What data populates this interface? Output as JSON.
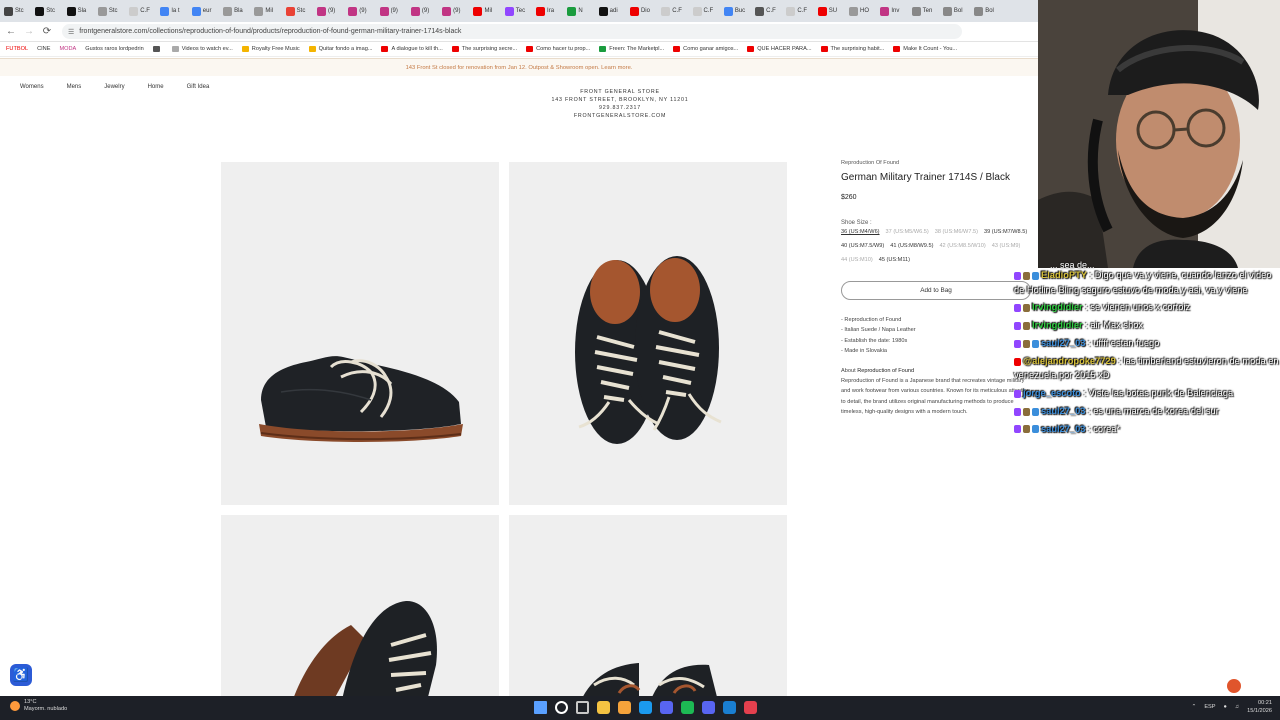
{
  "browser": {
    "tabs": [
      {
        "label": "Stc",
        "color": "#444"
      },
      {
        "label": "Stc",
        "color": "#111"
      },
      {
        "label": "Sla",
        "color": "#111"
      },
      {
        "label": "Stc",
        "color": "#999"
      },
      {
        "label": "C.F",
        "color": "#ccc"
      },
      {
        "label": "la t",
        "color": "#4285f4"
      },
      {
        "label": "eur",
        "color": "#4285f4"
      },
      {
        "label": "Bla",
        "color": "#999"
      },
      {
        "label": "Mil",
        "color": "#999"
      },
      {
        "label": "Stc",
        "color": "#e94235"
      },
      {
        "label": "(9)",
        "color": "#c13584"
      },
      {
        "label": "(9)",
        "color": "#c13584"
      },
      {
        "label": "(9)",
        "color": "#c13584"
      },
      {
        "label": "(9)",
        "color": "#c13584"
      },
      {
        "label": "(9)",
        "color": "#c13584"
      },
      {
        "label": "Mil",
        "color": "#e00"
      },
      {
        "label": "Tec",
        "color": "#9146ff"
      },
      {
        "label": "Ira",
        "color": "#e00"
      },
      {
        "label": "N",
        "color": "#1a9c3e"
      },
      {
        "label": "adi",
        "color": "#111"
      },
      {
        "label": "Dio",
        "color": "#e00"
      },
      {
        "label": "C.F",
        "color": "#ccc"
      },
      {
        "label": "C.F",
        "color": "#ccc"
      },
      {
        "label": "Buc",
        "color": "#4285f4"
      },
      {
        "label": "C.F",
        "color": "#555"
      },
      {
        "label": "C.F",
        "color": "#ccc"
      },
      {
        "label": "SU",
        "color": "#e00"
      },
      {
        "label": "HO",
        "color": "#999"
      },
      {
        "label": "Inv",
        "color": "#c13584"
      },
      {
        "label": "Ten",
        "color": "#888"
      },
      {
        "label": "Bol",
        "color": "#888"
      },
      {
        "label": "Bol",
        "color": "#888"
      }
    ],
    "url": "frontgeneralstore.com/collections/reproduction-of-found/products/reproduction-of-found-german-military-trainer-1714s-black",
    "bookmarks": [
      {
        "label": "FUTBOL",
        "color": "#e00",
        "folder": true
      },
      {
        "label": "CINE",
        "color": "#333",
        "folder": true
      },
      {
        "label": "MODA",
        "color": "#c13584",
        "folder": true
      },
      {
        "label": "Gustos raros lordpedrin",
        "color": "#333",
        "folder": true
      },
      {
        "label": "",
        "color": "#555",
        "folder": false
      },
      {
        "label": "Videos to watch ev...",
        "color": "#aaa",
        "folder": false
      },
      {
        "label": "Royalty Free Music",
        "color": "#f4b400",
        "folder": false
      },
      {
        "label": "Quitar fondo a imag...",
        "color": "#f4b400",
        "folder": false
      },
      {
        "label": "A dialogue to kill th...",
        "color": "#e00",
        "folder": false
      },
      {
        "label": "The surprising secre...",
        "color": "#e00",
        "folder": false
      },
      {
        "label": "Como hacer tu prop...",
        "color": "#e00",
        "folder": false
      },
      {
        "label": "Freen: The Marketpl...",
        "color": "#1a9c3e",
        "folder": false
      },
      {
        "label": "Como ganar amigos...",
        "color": "#e00",
        "folder": false
      },
      {
        "label": "QUE HACER PARA...",
        "color": "#e00",
        "folder": false
      },
      {
        "label": "The surprising habit...",
        "color": "#e00",
        "folder": false
      },
      {
        "label": "Make It Count - You...",
        "color": "#e00",
        "folder": false
      }
    ]
  },
  "store": {
    "announcement": "143 Front St closed for renovation from Jan 12. Outpost & Showroom open. Learn more.",
    "nav": [
      "Womens",
      "Mens",
      "Jewelry",
      "Home",
      "Gift Idea"
    ],
    "header": {
      "name": "FRONT GENERAL STORE",
      "address": "143 FRONT STREET, BROOKLYN, NY 11201",
      "phone": "929.837.2317",
      "site": "FRONTGENERALSTORE.COM"
    },
    "product": {
      "brand": "Reproduction Of Found",
      "title": "German Military Trainer 1714S / Black",
      "price": "$260",
      "size_label": "Shoe Size :",
      "sizes": [
        {
          "label": "36 (US:M4/W6)",
          "state": "selected"
        },
        {
          "label": "37 (US:M5/W6.5)",
          "state": "unavailable"
        },
        {
          "label": "38 (US:M6/W7.5)",
          "state": "unavailable"
        },
        {
          "label": "39 (US:M7/W8.5)",
          "state": "available"
        },
        {
          "label": "40 (US:M7.5/W9)",
          "state": "available"
        },
        {
          "label": "41 (US:M8/W9.5)",
          "state": "available"
        },
        {
          "label": "42 (US:M8.5/W10)",
          "state": "unavailable"
        },
        {
          "label": "43 (US:M9)",
          "state": "unavailable"
        },
        {
          "label": "44 (US:M10)",
          "state": "unavailable"
        },
        {
          "label": "45 (US:M11)",
          "state": "available"
        }
      ],
      "add_to_bag": "Add to Bag",
      "features": [
        "- Reproduction of Found",
        "- Italian Suede / Napa Leather",
        "- Establish the date: 1980s",
        "- Made in Slovakia"
      ],
      "about_prefix": "About ",
      "about_brand": "Reproduction of Found",
      "about_text": "Reproduction of Found is a Japanese brand that recreates vintage military and work footwear from various countries. Known for its meticulous attention to detail, the brand utilizes original manufacturing methods to produce timeless, high-quality designs with a modern touch."
    }
  },
  "stream": {
    "chat_fragment": "... sea de...",
    "chat": [
      {
        "user": "EladioPTY",
        "user_color": "#d8c13a",
        "text": " : Digo que va y viene, cuando lanzo el video de Hotline Bling seguro estuvo de moda y asi, va y viene",
        "badges": [
          "#9146ff",
          "#8a6d3b",
          "#3b8edb"
        ]
      },
      {
        "user": "Irvingdidier",
        "user_color": "#2ecc40",
        "text": " : se vienen unos x cortoiz",
        "badges": [
          "#9146ff",
          "#8a6d3b"
        ]
      },
      {
        "user": "Irvingdidier",
        "user_color": "#2ecc40",
        "text": " : air Max shox",
        "badges": [
          "#9146ff",
          "#8a6d3b"
        ]
      },
      {
        "user": "saul27_03",
        "user_color": "#3b8edb",
        "text": " : uffff estan fuego",
        "badges": [
          "#9146ff",
          "#8a6d3b",
          "#3b8edb"
        ]
      },
      {
        "user": "@alejandropoke7729",
        "user_color": "#d8c13a",
        "text": " : las timberland estuvieron de moda en venezuela por 2015 xD",
        "badges": [
          "#e00"
        ]
      },
      {
        "user": "jorge_escoto",
        "user_color": "#3b8edb",
        "text": " : Viste las botas punk de Balenciaga",
        "badges": [
          "#9146ff"
        ]
      },
      {
        "user": "saul27_03",
        "user_color": "#3b8edb",
        "text": " : es una marca de korea del sur",
        "badges": [
          "#9146ff",
          "#8a6d3b",
          "#3b8edb"
        ]
      },
      {
        "user": "saul27_03",
        "user_color": "#3b8edb",
        "text": " : corea*",
        "badges": [
          "#9146ff",
          "#8a6d3b",
          "#3b8edb"
        ]
      }
    ]
  },
  "taskbar": {
    "temperature": "13°C",
    "weather": "Mayorm. nublado",
    "language": "ESP",
    "time": "00:21",
    "date": "15/1/2026",
    "apps": [
      "#5aa0ff",
      "#ffffff",
      "#c8c8c8",
      "#f5c342",
      "#f5a33b",
      "#1b9aef",
      "#5865f2",
      "#1db954",
      "#5865f2",
      "#1a7fd1",
      "#e4404e"
    ]
  }
}
